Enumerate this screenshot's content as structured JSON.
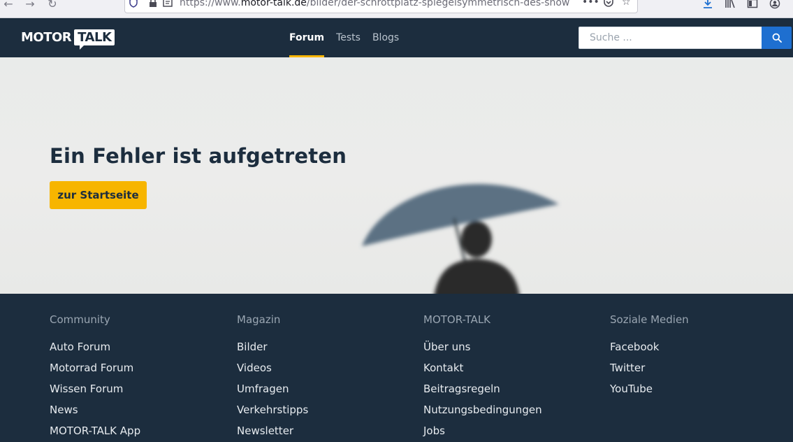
{
  "browser": {
    "url_prefix": "https://www.",
    "url_host": "motor-talk.de",
    "url_path": "/bilder/der-schrottplatz-spiegelsymmetrisch-des-show",
    "icons": [
      "back-icon",
      "forward-icon",
      "reload-icon",
      "shield-icon",
      "lock-icon",
      "reader-icon",
      "more-icon",
      "pocket-icon",
      "star-icon",
      "download-icon",
      "library-icon",
      "sidebar-icon",
      "account-icon"
    ]
  },
  "header": {
    "logo_motor": "MOTOR",
    "logo_talk": "TALK",
    "nav": [
      {
        "label": "Forum",
        "active": true
      },
      {
        "label": "Tests",
        "active": false
      },
      {
        "label": "Blogs",
        "active": false
      }
    ],
    "search_placeholder": "Suche ...",
    "colors": {
      "background": "#1c2d3e",
      "accent": "#f7b500",
      "search_button": "#1e6fd0"
    }
  },
  "hero": {
    "title": "Ein Fehler ist aufgetreten",
    "button_label": "zur Startseite"
  },
  "footer": {
    "columns": [
      {
        "heading": "Community",
        "links": [
          "Auto Forum",
          "Motorrad Forum",
          "Wissen Forum",
          "News",
          "MOTOR-TALK App"
        ]
      },
      {
        "heading": "Magazin",
        "links": [
          "Bilder",
          "Videos",
          "Umfragen",
          "Verkehrstipps",
          "Newsletter"
        ]
      },
      {
        "heading": "MOTOR-TALK",
        "links": [
          "Über uns",
          "Kontakt",
          "Beitragsregeln",
          "Nutzungsbedingungen",
          "Jobs"
        ]
      },
      {
        "heading": "Soziale Medien",
        "links": [
          "Facebook",
          "Twitter",
          "YouTube"
        ]
      }
    ]
  }
}
